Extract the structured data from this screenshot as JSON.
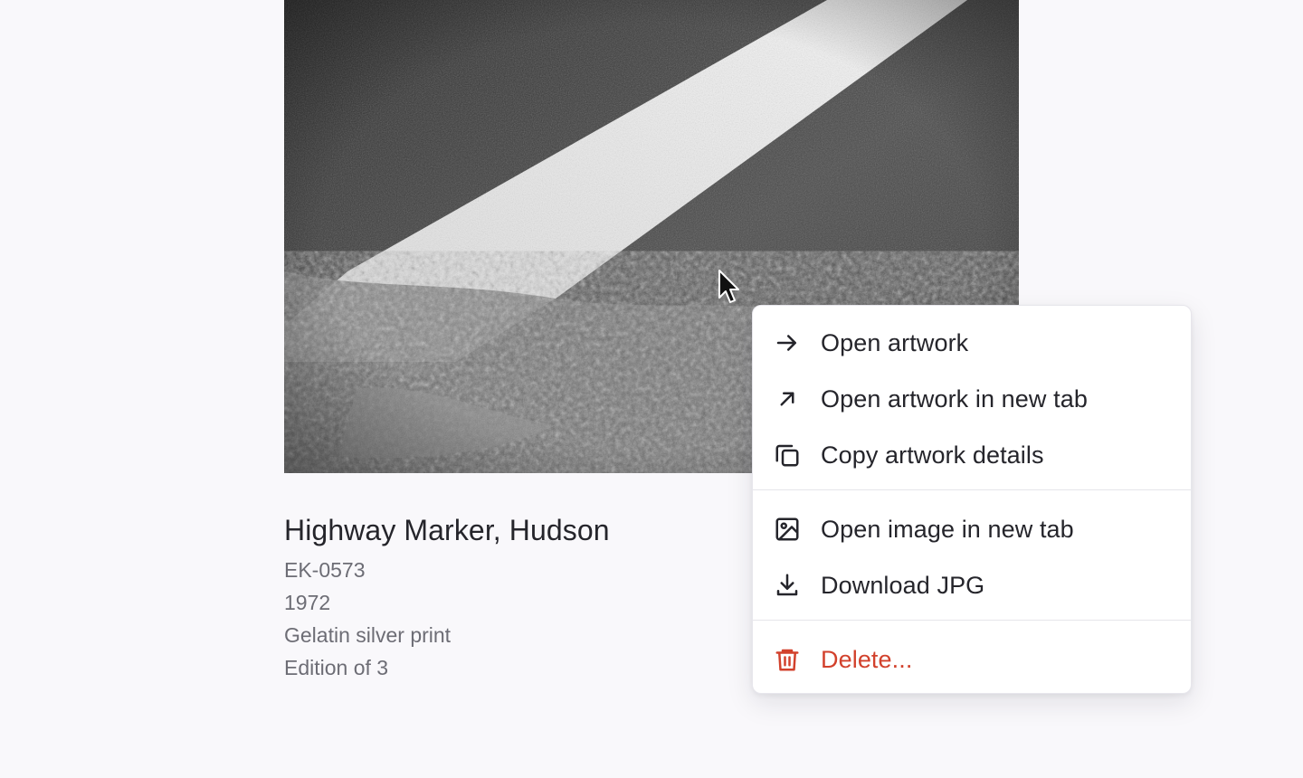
{
  "artwork": {
    "title": "Highway Marker, Hudson",
    "details": [
      "EK-0573",
      "1972",
      "Gelatin silver print",
      "Edition of 3"
    ]
  },
  "context_menu": {
    "items": [
      {
        "label": "Open artwork",
        "icon": "arrow-right-icon"
      },
      {
        "label": "Open artwork in new tab",
        "icon": "arrow-up-right-icon"
      },
      {
        "label": "Copy artwork details",
        "icon": "copy-icon"
      },
      {
        "label": "Open image in new tab",
        "icon": "image-icon"
      },
      {
        "label": "Download JPG",
        "icon": "download-icon"
      },
      {
        "label": "Delete...",
        "icon": "trash-icon"
      }
    ]
  },
  "colors": {
    "background": "#f9f8fb",
    "danger": "#d2412c",
    "text": "#25252b",
    "muted": "#6d6d75"
  }
}
